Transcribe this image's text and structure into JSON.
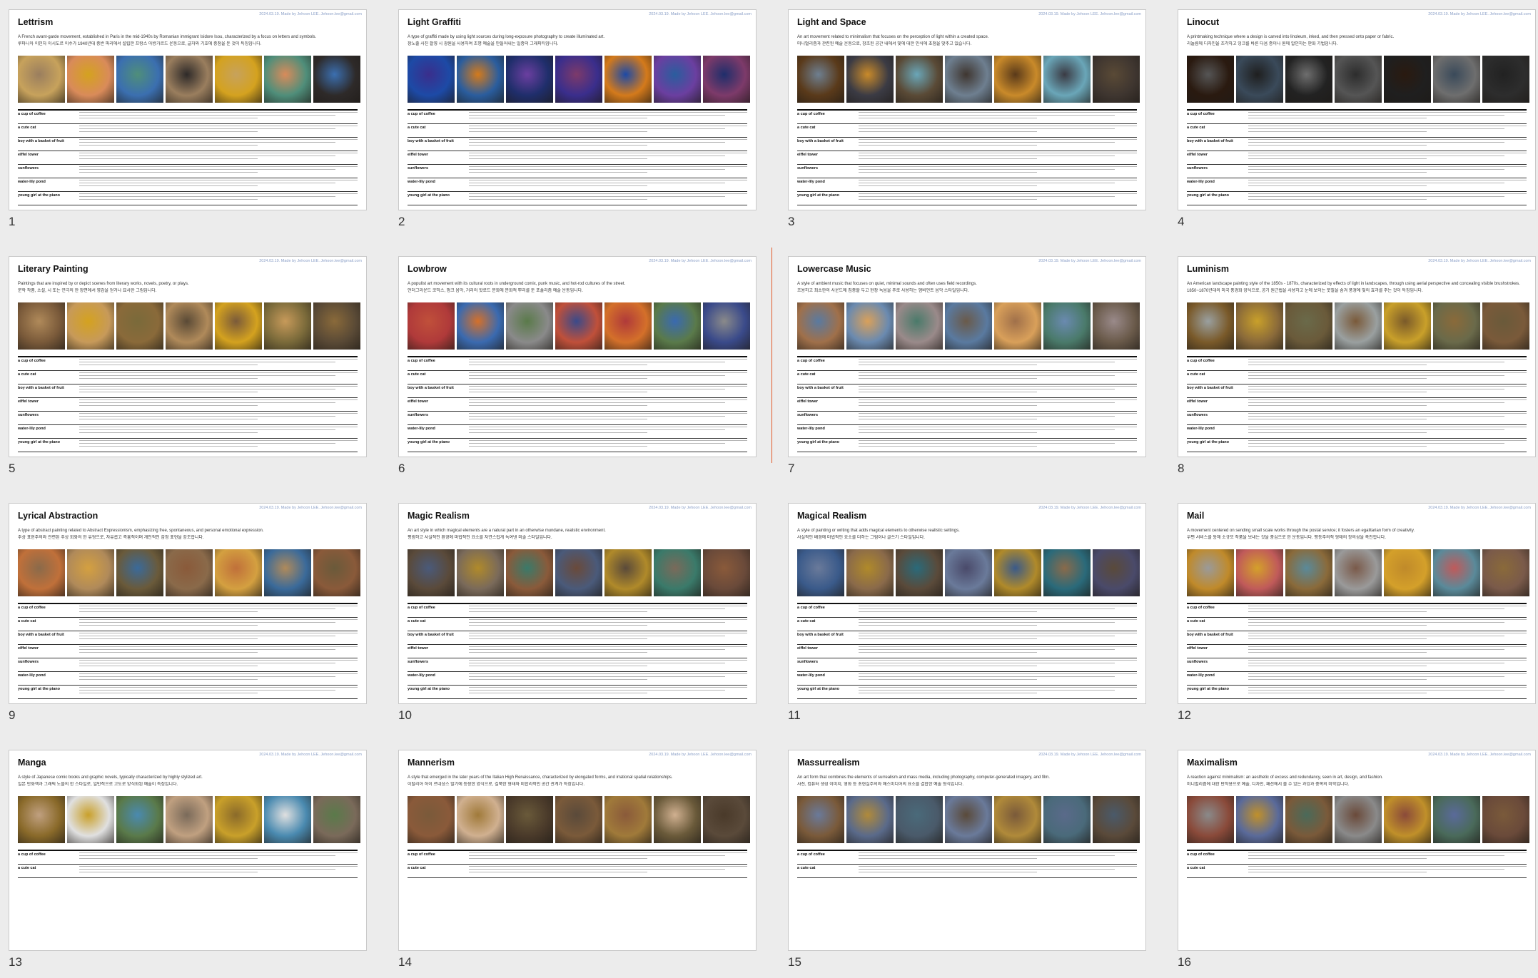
{
  "credit": "2024.03.19. Made by Jehoon LEE. Jehoon.lee@gmail.com",
  "prompts": [
    "a cup of coffee",
    "a cute cat",
    "boy with a basket of fruit",
    "eiffel tower",
    "sunflowers",
    "water-lily pond",
    "young girl at the piano"
  ],
  "slides": [
    {
      "number": "1",
      "title": "Lettrism",
      "desc": "A French avant-garde movement, established in Paris in the mid-1940s by Romanian immigrant Isidore Isou, characterized by a focus on letters and symbols.",
      "desc_ko": "루마니아 이민자 이시도르 이수가 1940년대 중반 파리에서 설립한 프랑스 아방가르드 운동으로, 글자와 기호에 중점을 둔 것이 특징입니다.",
      "palette": [
        "#c7a25c",
        "#d98b5a",
        "#3b6fb0",
        "#9a7e5e",
        "#d4a21f",
        "#4f8e7a",
        "#2e2a29"
      ],
      "prompt_rows": 7
    },
    {
      "number": "2",
      "title": "Light Graffiti",
      "desc": "A type of graffiti made by using light sources during long-exposure photography to create illuminated art.",
      "desc_ko": "장노출 사진 촬영 시 광원을 사용하여 조명 예술을 만들어내는 일종의 그래피티입니다.",
      "palette": [
        "#1d4aa6",
        "#2a5d9e",
        "#1f2e6b",
        "#3a2e8c",
        "#d47a1b",
        "#6b3fa0",
        "#7d3a6a"
      ],
      "prompt_rows": 7
    },
    {
      "number": "3",
      "title": "Light and Space",
      "desc": "An art movement related to minimalism that focuses on the perception of light within a created space.",
      "desc_ko": "미니멀리즘과 관련된 예술 운동으로, 창조된 공간 내에서 빛에 대한 인식에 초점을 맞추고 있습니다.",
      "palette": [
        "#5a3a1a",
        "#3b3b44",
        "#5a4a36",
        "#6e7f90",
        "#c98a2a",
        "#6aa6b8",
        "#3f3630"
      ],
      "prompt_rows": 7
    },
    {
      "number": "4",
      "title": "Linocut",
      "desc": "A printmaking technique where a design is carved into linoleum, inked, and then pressed onto paper or fabric.",
      "desc_ko": "리놀륨에 디자인을 조각하고 잉크를 바른 다음 종이나 원에 압인하는 판화 기법입니다.",
      "palette": [
        "#2a1a10",
        "#3a4a5a",
        "#222222",
        "#555555",
        "#1f1f1f",
        "#6e6e6e",
        "#2d2d2d"
      ],
      "prompt_rows": 7
    },
    {
      "number": "5",
      "title": "Literary Painting",
      "desc": "Paintings that are inspired by or depict scenes from literary works, novels, poetry, or plays.",
      "desc_ko": "문학 작품, 소설, 시 또는 연극의 한 장면에서 영감을 얻거나 묘사한 그림입니다.",
      "palette": [
        "#7a5a3a",
        "#c79a5a",
        "#8a6a3a",
        "#b08a5a",
        "#d4a21f",
        "#7a6a3a",
        "#5a4a36"
      ],
      "prompt_rows": 7
    },
    {
      "number": "6",
      "title": "Lowbrow",
      "desc": "A populist art movement with its cultural roots in underground comix, punk music, and hot-rod cultures of the street.",
      "desc_ko": "언더그라운드 코믹스, 펑크 음악, 거리의 핫로드 문화에 문화적 뿌리를 둔 포퓰리즘 예술 운동입니다.",
      "palette": [
        "#b03a3a",
        "#3a6ab0",
        "#8a8a8a",
        "#c0503a",
        "#d4702a",
        "#5a7a4a",
        "#3a4a8a"
      ],
      "prompt_rows": 7
    },
    {
      "number": "7",
      "title": "Lowercase Music",
      "desc": "A style of ambient music that focuses on quiet, minimal sounds and often uses field recordings.",
      "desc_ko": "조용하고 최소한의 사운드에 집중할 두고 현장 녹음을 주로 사용하는 앰비언트 음악 스타일입니다.",
      "palette": [
        "#a0704a",
        "#6a8ab0",
        "#9a8a8a",
        "#5a7aa0",
        "#d9a05a",
        "#4a7a6a",
        "#6a5a4a"
      ],
      "prompt_rows": 7
    },
    {
      "number": "8",
      "title": "Luminism",
      "desc": "An American landscape painting style of the 1850s - 1870s, characterized by effects of light in landscapes, through using aerial perspective and concealing visible brushstrokes.",
      "desc_ko": "1850~1870년대의 미국 풍경화 양식으로, 공기 원근법을 사용하고 눈에 보이는 붓질을 숨겨 풍경에 빛의 효과를 주는 것이 특징입니다.",
      "palette": [
        "#7a5a2a",
        "#8a6a3a",
        "#6a5a3a",
        "#9aa0a0",
        "#c9a02a",
        "#6a6a4a",
        "#7a5a3a"
      ],
      "prompt_rows": 7
    },
    {
      "number": "9",
      "title": "Lyrical Abstraction",
      "desc": "A type of abstract painting related to Abstract Expressionism, emphasizing free, spontaneous, and personal emotional expression.",
      "desc_ko": "추상 표현주의와 관련된 추상 회화의 한 유형으로, 자유롭고 즉흥적이며 개인적인 감정 표현을 강조합니다.",
      "palette": [
        "#c0703a",
        "#b08a5a",
        "#6a5a3a",
        "#8a6a4a",
        "#d4a040",
        "#3a6a9a",
        "#8a5a3a"
      ],
      "prompt_rows": 7
    },
    {
      "number": "10",
      "title": "Magic Realism",
      "desc": "An art style in which magical elements are a natural part in an otherwise mundane, realistic environment.",
      "desc_ko": "평범하고 사실적인 환경에 마법적인 요소를 자연스럽게 녹여낸 미술 스타일입니다.",
      "palette": [
        "#5a4a3a",
        "#7a6a5a",
        "#8a5a3a",
        "#4a5a7a",
        "#b08a2a",
        "#3a7a6a",
        "#6a4a3a"
      ],
      "prompt_rows": 7
    },
    {
      "number": "11",
      "title": "Magical Realism",
      "desc": "A style of painting or writing that adds magical elements to otherwise realistic settings.",
      "desc_ko": "사실적인 배경에 마법적인 요소를 더하는 그림이나 글쓰기 스타일입니다.",
      "palette": [
        "#3a5a8a",
        "#8a6a4a",
        "#5a4a3a",
        "#6a7a9a",
        "#b08a2a",
        "#2a6a7a",
        "#4a4a6a"
      ],
      "prompt_rows": 7
    },
    {
      "number": "12",
      "title": "Mail",
      "desc": "A movement centered on sending small scale works through the postal service; it fosters an egalitarian form of creativity.",
      "desc_ko": "우편 서비스를 통해 소규모 작품을 보내는 것을 중심으로 한 운동입니다. 평등주의적 형태의 창의성을 촉진합니다.",
      "palette": [
        "#c08a2a",
        "#c05a5a",
        "#8a6a3a",
        "#9a9a9a",
        "#d4a02a",
        "#5a8a9a",
        "#7a5a4a"
      ],
      "prompt_rows": 7
    },
    {
      "number": "13",
      "title": "Manga",
      "desc": "A style of Japanese comic books and graphic novels, typically characterized by highly stylized art.",
      "desc_ko": "일본 만화책과 그래픽 노블의 한 스타일로, 일반적으로 고도로 양식화된 예술이 특징입니다.",
      "palette": [
        "#8a6a2a",
        "#e0e0e0",
        "#5a7a4a",
        "#c0a080",
        "#c9a02a",
        "#4a8ab0",
        "#7a6a5a"
      ],
      "prompt_rows": 2
    },
    {
      "number": "14",
      "title": "Mannerism",
      "desc": "A style that emerged in the later years of the Italian High Renaissance, characterized by elongated forms, and irrational spatial relationships.",
      "desc_ko": "이탈리아 하이 르네상스 말기에 등장한 양식으로, 길쭉한 형태와 비합리적인 공간 관계가 특징입니다.",
      "palette": [
        "#8a5a3a",
        "#d0b090",
        "#4a3a2a",
        "#7a5a3a",
        "#a07a3a",
        "#6a5a3a",
        "#5a4a3a"
      ],
      "prompt_rows": 2
    },
    {
      "number": "15",
      "title": "Massurrealism",
      "desc": "An art form that combines the elements of surrealism and mass media, including photography, computer-generated imagery, and film.",
      "desc_ko": "사진, 컴퓨터 생성 이미지, 영화 등 초현실주의와 매스미디어의 요소를 결합한 예술 형식입니다.",
      "palette": [
        "#7a5a3a",
        "#5a6a8a",
        "#4a5a6a",
        "#6a7a9a",
        "#b08a3a",
        "#4a6a7a",
        "#5a4a3a"
      ],
      "prompt_rows": 2
    },
    {
      "number": "16",
      "title": "Maximalism",
      "desc": "A reaction against minimalism: an aesthetic of excess and redundancy, seen in art, design, and fashion.",
      "desc_ko": "미니멀리즘에 대한 반작용으로 예술, 디자인, 패션에서 볼 수 있는 과잉과 중복의 미학입니다.",
      "palette": [
        "#8a4a3a",
        "#5a6a9a",
        "#7a5a3a",
        "#8a8a8a",
        "#c0902a",
        "#4a6a5a",
        "#6a4a3a"
      ],
      "prompt_rows": 2
    }
  ]
}
